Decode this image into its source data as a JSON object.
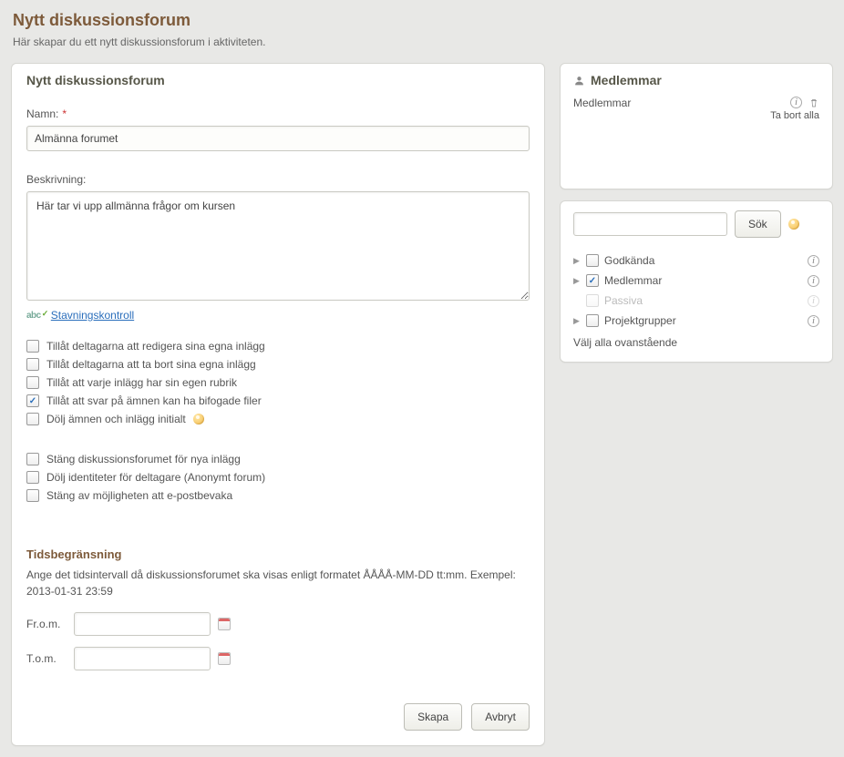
{
  "header": {
    "title": "Nytt diskussionsforum",
    "subtitle": "Här skapar du ett nytt diskussionsforum i aktiviteten."
  },
  "form": {
    "panel_title": "Nytt diskussionsforum",
    "name_label": "Namn:",
    "name_value": "Almänna forumet",
    "desc_label": "Beskrivning:",
    "desc_value": "Här tar vi upp allmänna frågor om kursen",
    "spellcheck": "Stavningskontroll",
    "options1": [
      {
        "label": "Tillåt deltagarna att redigera sina egna inlägg",
        "checked": false
      },
      {
        "label": "Tillåt deltagarna att ta bort sina egna inlägg",
        "checked": false
      },
      {
        "label": "Tillåt att varje inlägg har sin egen rubrik",
        "checked": false
      },
      {
        "label": "Tillåt att svar på ämnen kan ha bifogade filer",
        "checked": true
      },
      {
        "label": "Dölj ämnen och inlägg initialt",
        "checked": false,
        "help": true
      }
    ],
    "options2": [
      {
        "label": "Stäng diskussionsforumet för nya inlägg",
        "checked": false
      },
      {
        "label": "Dölj identiteter för deltagare (Anonymt forum)",
        "checked": false
      },
      {
        "label": "Stäng av möjligheten att e-postbevaka",
        "checked": false
      }
    ],
    "time": {
      "title": "Tidsbegränsning",
      "desc": "Ange det tidsintervall då diskussionsforumet ska visas enligt formatet ÅÅÅÅ-MM-DD tt:mm. Exempel: 2013-01-31 23:59",
      "from_label": "Fr.o.m.",
      "to_label": "T.o.m.",
      "from_value": "",
      "to_value": ""
    },
    "buttons": {
      "create": "Skapa",
      "cancel": "Avbryt"
    }
  },
  "members": {
    "panel_title": "Medlemmar",
    "label": "Medlemmar",
    "remove_all": "Ta bort alla",
    "search_button": "Sök",
    "search_value": "",
    "tree": [
      {
        "label": "Godkända",
        "checked": false,
        "arrow": true,
        "muted": false
      },
      {
        "label": "Medlemmar",
        "checked": true,
        "arrow": true,
        "muted": false
      },
      {
        "label": "Passiva",
        "checked": false,
        "arrow": false,
        "muted": true
      },
      {
        "label": "Projektgrupper",
        "checked": false,
        "arrow": true,
        "muted": false
      }
    ],
    "select_all": "Välj alla ovanstående"
  }
}
